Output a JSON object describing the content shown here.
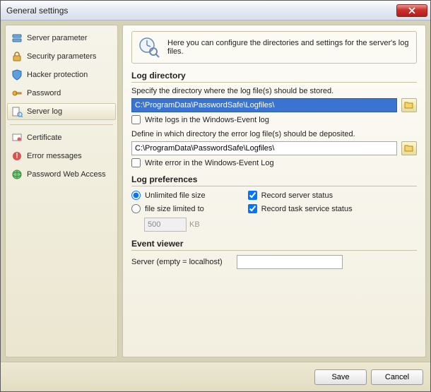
{
  "window": {
    "title": "General settings"
  },
  "sidebar": {
    "items": [
      {
        "label": "Server parameter"
      },
      {
        "label": "Security parameters"
      },
      {
        "label": "Hacker protection"
      },
      {
        "label": "Password"
      },
      {
        "label": "Server log"
      },
      {
        "label": "Certificate"
      },
      {
        "label": "Error messages"
      },
      {
        "label": "Password Web Access"
      }
    ]
  },
  "banner": {
    "text": "Here you can configure the directories and settings for the server's log files."
  },
  "sections": {
    "log_dir": {
      "heading": "Log directory",
      "hint": "Specify the directory where the log file(s) should be stored.",
      "path": "C:\\ProgramData\\PasswordSafe\\Logfiles\\",
      "write_event": "Write logs in the Windows-Event log",
      "err_hint": "Define in which directory the error log file(s) should be deposited.",
      "err_path": "C:\\ProgramData\\PasswordSafe\\Logfiles\\",
      "write_err_event": "Write error in the Windows-Event Log"
    },
    "prefs": {
      "heading": "Log preferences",
      "unlimited": "Unlimited file size",
      "limited": "file size limited to",
      "limit_value": "500",
      "limit_unit": "KB",
      "record_server": "Record server status",
      "record_task": "Record task service status"
    },
    "event": {
      "heading": "Event viewer",
      "server_label": "Server (empty = localhost)",
      "server_value": ""
    }
  },
  "footer": {
    "save": "Save",
    "cancel": "Cancel"
  }
}
